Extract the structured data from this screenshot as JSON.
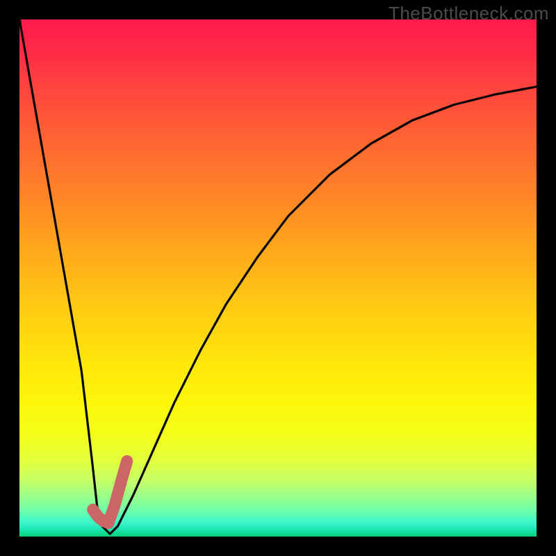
{
  "watermark": "TheBottleneck.com",
  "colors": {
    "frame": "#000000",
    "curve": "#000000",
    "marker": "#cc6666",
    "gradient_top": "#ff1a4c",
    "gradient_bottom": "#06d17a"
  },
  "chart_data": {
    "type": "line",
    "title": "",
    "xlabel": "",
    "ylabel": "",
    "xlim": [
      0,
      100
    ],
    "ylim": [
      0,
      100
    ],
    "grid": false,
    "legend": false,
    "series": [
      {
        "name": "bottleneck-curve",
        "x": [
          0,
          3,
          6,
          9,
          12,
          14,
          15,
          16,
          17.5,
          19,
          22,
          26,
          30,
          35,
          40,
          46,
          52,
          60,
          68,
          76,
          84,
          92,
          100
        ],
        "y": [
          100,
          83,
          66,
          49,
          32,
          15,
          6,
          2,
          0.5,
          2,
          8,
          17,
          26,
          36,
          45,
          54,
          62,
          70,
          76,
          80.5,
          83.5,
          85.5,
          87
        ]
      }
    ],
    "marker_segment": {
      "name": "highlight-segment",
      "x": [
        14.2,
        15.2,
        16.2,
        17.2,
        18.4,
        19.6,
        20.8
      ],
      "y": [
        5.2,
        3.8,
        3.0,
        2.6,
        6.0,
        10.4,
        14.6
      ]
    }
  }
}
